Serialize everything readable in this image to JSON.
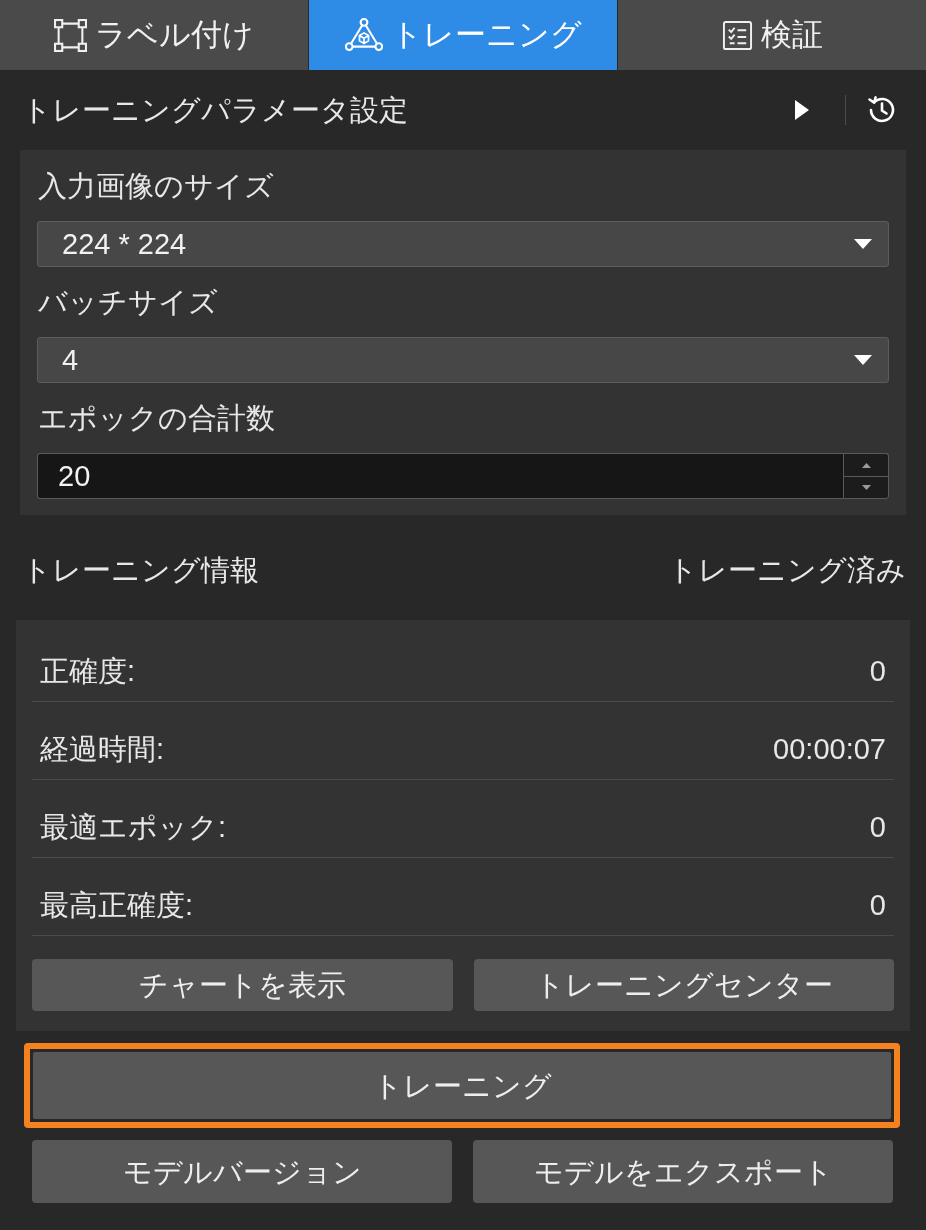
{
  "tabs": [
    {
      "label": "ラベル付け",
      "kind": "annotate",
      "selected": false
    },
    {
      "label": "トレーニング",
      "kind": "train",
      "selected": true
    },
    {
      "label": "検証",
      "kind": "validate",
      "selected": false
    }
  ],
  "parameter_panel": {
    "title": "トレーニングパラメータ設定",
    "fields": [
      {
        "kind": "select",
        "label": "入力画像のサイズ",
        "value": "224 * 224"
      },
      {
        "kind": "select",
        "label": "バッチサイズ",
        "value": "4"
      },
      {
        "kind": "number",
        "label": "エポックの合計数",
        "value": "20"
      }
    ]
  },
  "info_panel": {
    "title": "トレーニング情報",
    "status": "トレーニング済み",
    "metrics": [
      {
        "label": "正確度:",
        "value": "0"
      },
      {
        "label": "経過時間:",
        "value": "00:00:07"
      },
      {
        "label": "最適エポック:",
        "value": "0"
      },
      {
        "label": "最高正確度:",
        "value": "0"
      }
    ],
    "buttons": [
      "チャートを表示",
      "トレーニングセンター"
    ]
  },
  "train_button": {
    "label": "トレーニング",
    "highlighted": true
  },
  "bottom_buttons": [
    "モデルバージョン",
    "モデルをエクスポート"
  ]
}
